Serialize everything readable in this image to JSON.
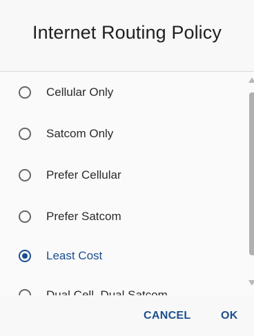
{
  "dialog": {
    "title": "Internet Routing Policy",
    "options": [
      {
        "label": "Cellular Only",
        "checked": false
      },
      {
        "label": "Satcom Only",
        "checked": false
      },
      {
        "label": "Prefer Cellular",
        "checked": false
      },
      {
        "label": "Prefer Satcom",
        "checked": false
      },
      {
        "label": "Least Cost",
        "checked": true
      },
      {
        "label": "Dual Cell, Dual Satcom",
        "checked": false
      }
    ],
    "selected_index": 4,
    "buttons": {
      "cancel": "CANCEL",
      "ok": "OK"
    }
  },
  "colors": {
    "accent": "#1a4f8f",
    "radio_unchecked": "#666666",
    "text": "#2a2a2a",
    "background": "#f8f8f8"
  }
}
